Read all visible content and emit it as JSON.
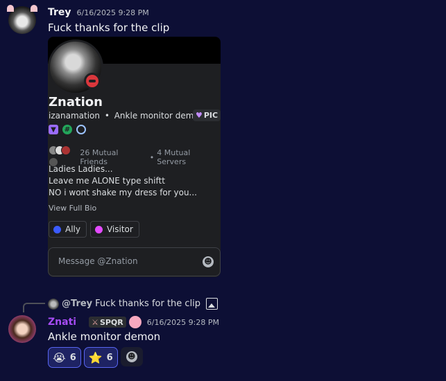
{
  "message1": {
    "author": "Trey",
    "timestamp": "6/16/2025 9:28 PM",
    "text": "Fuck thanks for the clip"
  },
  "profile_card": {
    "display_name": "Znation",
    "username": "izanamation",
    "separator": "•",
    "pronouns_or_status": "Ankle monitor demon",
    "pic_badge": "PIC",
    "mutual_friends": "26 Mutual Friends",
    "mutual_servers": "4 Mutual Servers",
    "bio_lines": [
      "Ladies Ladies...",
      "Leave me ALONE type shiftt",
      "NO i wont shake my dress for you..."
    ],
    "view_bio": "View Full Bio",
    "roles": [
      {
        "label": "Ally",
        "color": "#3b5bff"
      },
      {
        "label": "Visitor",
        "color": "#e34bff"
      }
    ],
    "message_placeholder": "Message @Znation",
    "hash_badge": "#"
  },
  "message2": {
    "reply": {
      "author": "@Trey",
      "text": "Fuck thanks for the clip"
    },
    "author": "Znati",
    "tag": "SPQR",
    "timestamp": "6/16/2025 9:28 PM",
    "text": "Ankle monitor demon",
    "reactions": [
      {
        "emoji": "😭",
        "count": "6"
      },
      {
        "emoji": "⭐",
        "count": "6"
      }
    ]
  }
}
